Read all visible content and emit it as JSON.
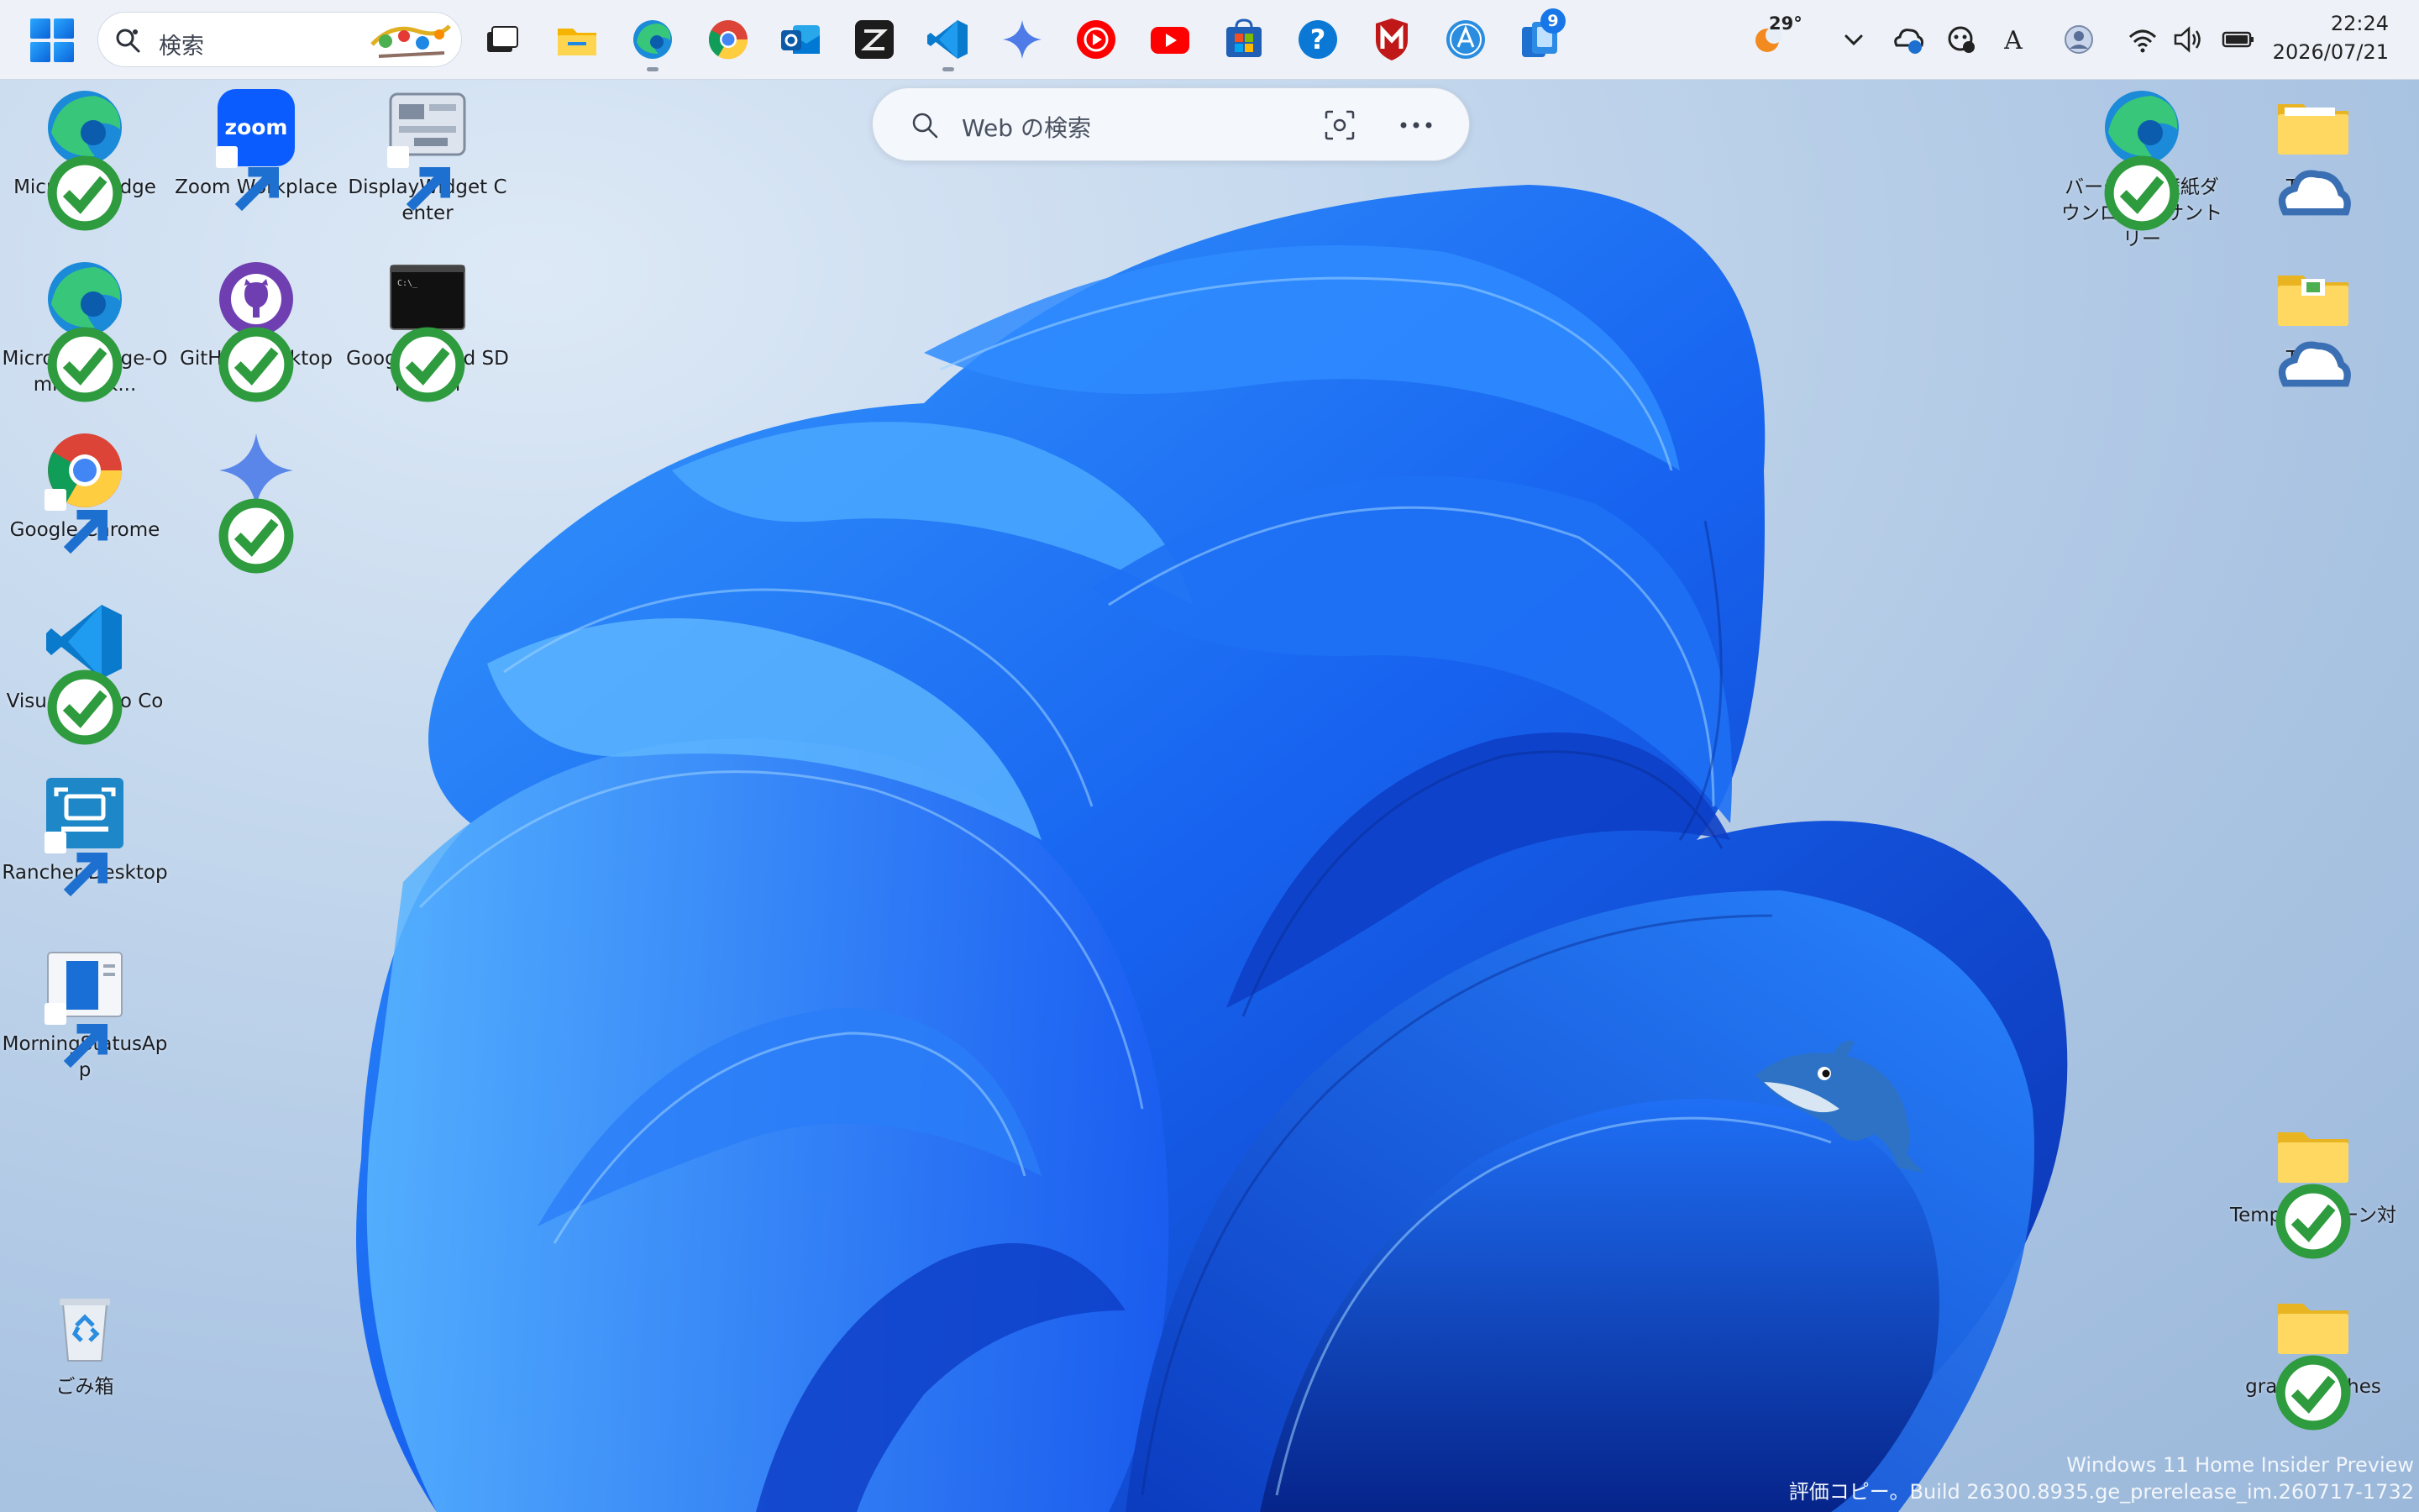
{
  "taskbar": {
    "search_placeholder": "検索",
    "apps": [
      {
        "name": "task-view-icon"
      },
      {
        "name": "file-explorer-icon"
      },
      {
        "name": "edge-icon"
      },
      {
        "name": "chrome-icon"
      },
      {
        "name": "outlook-icon"
      },
      {
        "name": "zed-editor-icon"
      },
      {
        "name": "vscode-icon"
      },
      {
        "name": "gemini-icon"
      },
      {
        "name": "youtube-music-icon"
      },
      {
        "name": "youtube-icon"
      },
      {
        "name": "microsoft-store-icon"
      },
      {
        "name": "help-icon"
      },
      {
        "name": "mcafee-icon"
      },
      {
        "name": "app-store-beta-icon"
      },
      {
        "name": "phone-link-icon"
      }
    ],
    "notification_badge": "9",
    "weather_temp": "29°",
    "clock": {
      "time": "22:24",
      "date": "2026/07/21"
    }
  },
  "web_search": {
    "placeholder": "Web の検索"
  },
  "desktop": {
    "left_icons": [
      {
        "label": "Microsoft Edge"
      },
      {
        "label": "Zoom Workplace"
      },
      {
        "label": "DisplayWidget Center"
      },
      {
        "label": "Microsoft Edge-OmniBook..."
      },
      {
        "label": "GitHub Desktop"
      },
      {
        "label": "Google Cloud SDK Shell"
      },
      {
        "label": "Google Chrome"
      },
      {
        "label": "Gemini"
      },
      {
        "label": "Visual Studio Code"
      },
      {
        "label": "Rancher Desktop"
      },
      {
        "label": "MorningStatusApp"
      },
      {
        "label": "ごみ箱"
      }
    ],
    "right_icons": [
      {
        "label": "バーチャル壁紙ダウンロード-サントリー"
      },
      {
        "label": "Task1"
      },
      {
        "label": "Task2"
      },
      {
        "label": "Temp - クリーン対象"
      },
      {
        "label": "gradle-caches"
      }
    ]
  },
  "watermark": {
    "line1": "Windows 11 Home Insider Preview",
    "line2": "評価コピー。Build 26300.8935.ge_prerelease_im.260717-1732"
  },
  "colors": {
    "accent": "#0a63d8",
    "wallpaper_blue": "#1a5ff0"
  }
}
